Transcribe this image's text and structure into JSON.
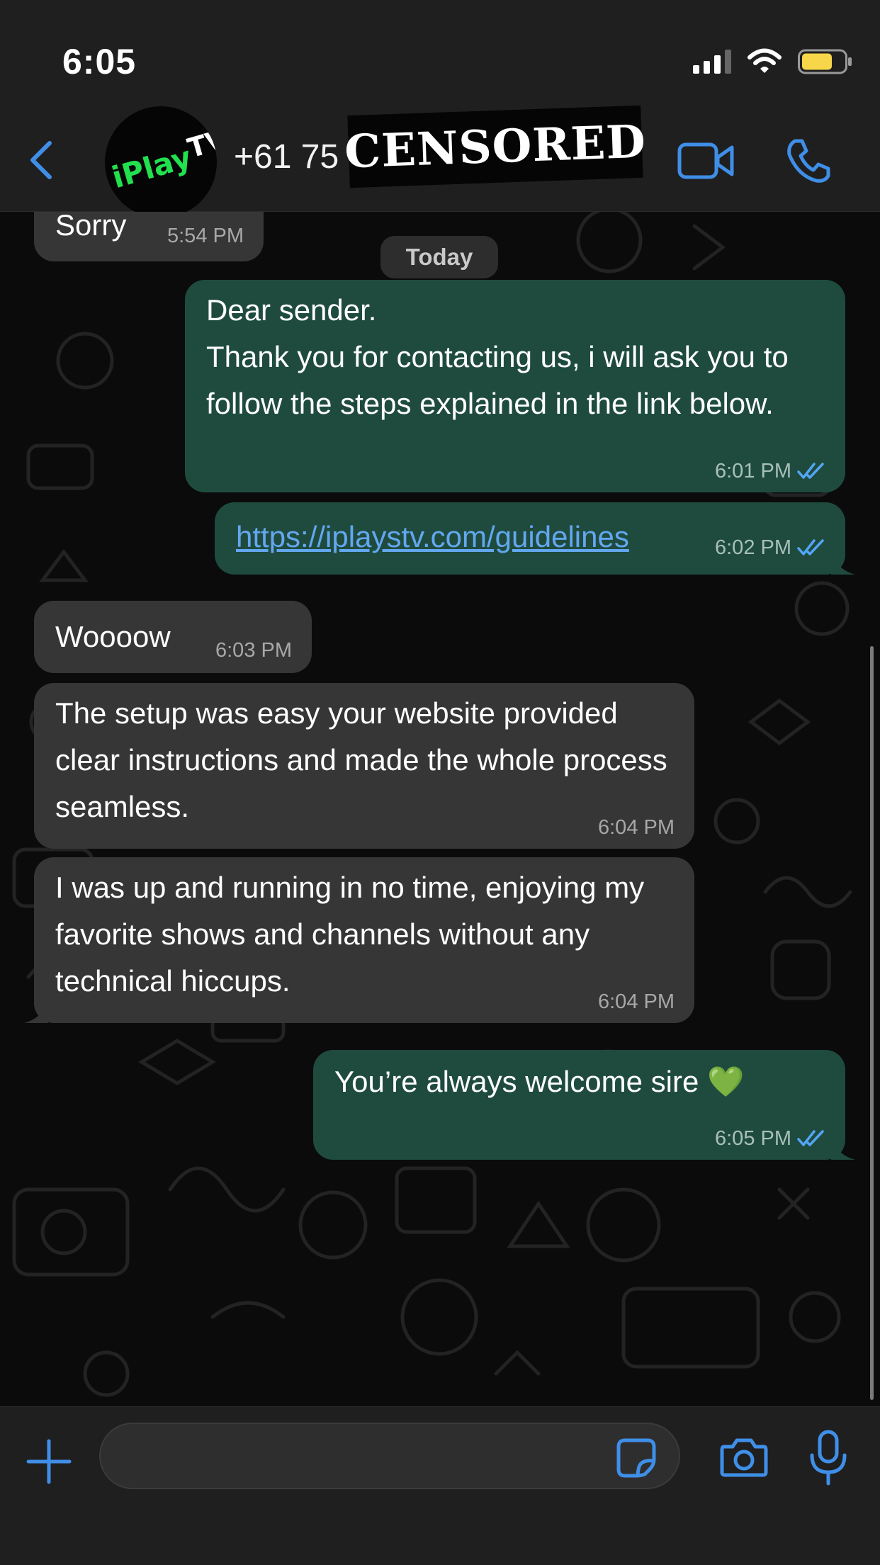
{
  "status_bar": {
    "time": "6:05"
  },
  "header": {
    "avatar_text_main": "iPlay",
    "avatar_text_sup": "TV",
    "contact_name": "+61 75",
    "censor_label": "CENSORED"
  },
  "chat": {
    "date_separator": "Today",
    "messages": [
      {
        "text": "Sorry",
        "time": "5:54 PM"
      },
      {
        "text": "Dear sender.\nThank you for contacting us, i will ask you to follow the steps explained in the link below.",
        "time": "6:01 PM"
      },
      {
        "text": "https://iplaystv.com/guidelines",
        "time": "6:02 PM"
      },
      {
        "text": "Woooow",
        "time": "6:03 PM"
      },
      {
        "text": "The setup was easy your website provided clear instructions and made the whole process seamless.",
        "time": "6:04 PM"
      },
      {
        "text": "I was up and running in no time, enjoying my favorite shows and channels without any technical hiccups.",
        "time": "6:04 PM"
      },
      {
        "text": "You’re always welcome sire 💚",
        "time": "6:05 PM"
      }
    ]
  },
  "icons": {
    "back": "chevron-left-icon",
    "video": "video-camera-icon",
    "call": "phone-icon",
    "attach": "plus-icon",
    "sticker": "sticker-icon",
    "camera": "camera-icon",
    "mic": "microphone-icon",
    "read_receipt": "double-check-icon"
  },
  "colors": {
    "accent": "#3f8fe8",
    "outgoing_bubble": "#1f4b3f",
    "incoming_bubble": "#363636",
    "read_check": "#53a6f5",
    "battery": "#f7d64a"
  }
}
